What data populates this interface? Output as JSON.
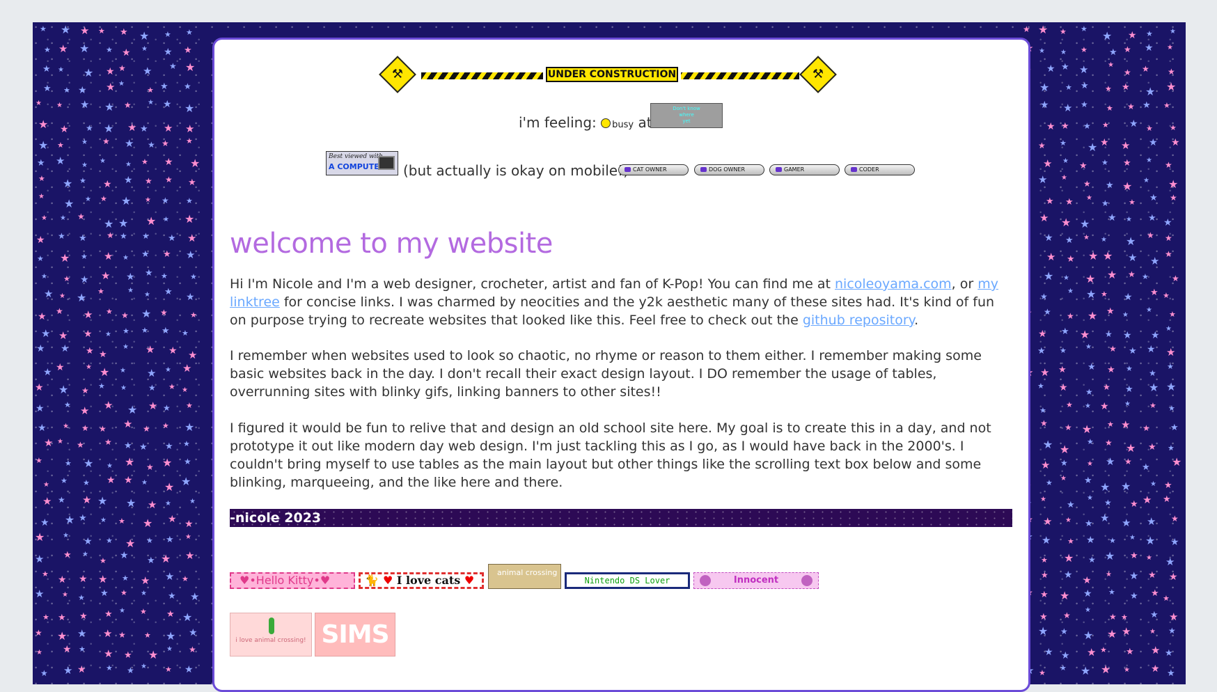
{
  "construction": {
    "label": "UNDER CONSTRUCTION"
  },
  "status": {
    "prefix": "i'm feeling:",
    "mood": "busy",
    "connector": "at",
    "place_text": "Don't know\nwhere\nyet"
  },
  "compat": {
    "best_viewed_line1": "Best viewed with",
    "best_viewed_line2": "A COMPUTER",
    "note": "(but actually is okay on mobile!)",
    "pills": [
      "CAT OWNER",
      "DOG OWNER",
      "GAMER",
      "CODER"
    ]
  },
  "main": {
    "title": "welcome to my website",
    "p1_a": "Hi I'm Nicole and I'm a web designer, crocheter, artist and fan of K-Pop! You can find me at ",
    "link_site": "nicoleoyama.com",
    "p1_b": ", or ",
    "link_linktree": "my linktree",
    "p1_c": " for concise links. I was charmed by neocities and the y2k aesthetic many of these sites had. It's kind of fun on purpose trying to recreate websites that looked like this. Feel free to check out the ",
    "link_github": "github repository",
    "p1_d": ".",
    "p2": "I remember when websites used to look so chaotic, no rhyme or reason to them either. I remember making some basic websites back in the day. I don't recall their exact design layout. I DO remember the usage of tables, overrunning sites with blinky gifs, linking banners to other sites!!",
    "p3": "I figured it would be fun to relive that and design an old school site here. My goal is to create this in a day, and not prototype it out like modern day web design. I'm just tackling this as I go, as I would have back in the 2000's. I couldn't bring myself to use tables as the main layout but other things like the scrolling text box below and some blinking, marqueeing, and the like here and there.",
    "signature": "-nicole 2023"
  },
  "banners": {
    "hello_kitty": "♥•Hello Kitty•♥",
    "love_cats": "I love cats",
    "animal_crossing_mini": "animal crossing",
    "nintendo_ds": "Nintendo DS Lover",
    "innocent": "Innocent",
    "animal_crossing_text": "i love animal crossing!",
    "sims": "SIMS"
  },
  "colors": {
    "background": "#1a1466",
    "title": "#b36ae0",
    "link": "#6aa8ff",
    "signature_bar": "#2d0a55",
    "panel_border": "#6b4bd8"
  }
}
